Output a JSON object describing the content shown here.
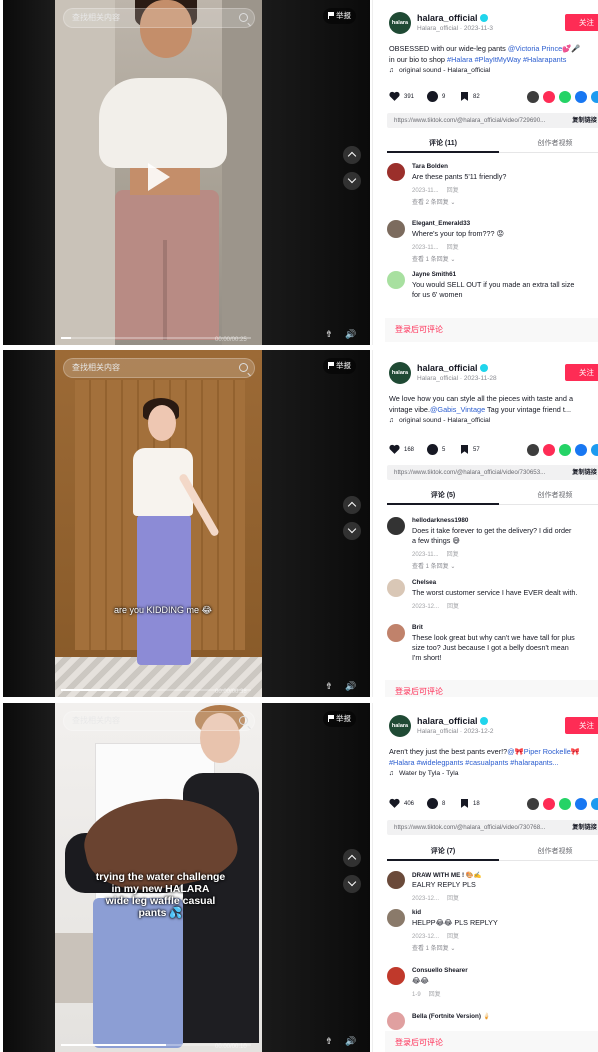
{
  "panels": [
    {
      "search_placeholder": "查找相关内容",
      "report_label": "举报",
      "video_time": "00:00/00:25",
      "progress": 0.05,
      "caption": [],
      "username": "halara_official",
      "avatar_text": "halara",
      "subline": "Halara_official · 2023-11-3",
      "follow_label": "关注",
      "desc_lines": [
        [
          {
            "t": "OBSESSED with our wide-leg pants "
          },
          {
            "t": "@Victoria Prince",
            "link": true
          },
          {
            "t": "💕🎤"
          }
        ],
        [
          {
            "t": "in our bio to shop "
          },
          {
            "t": "#Halara #PlayItMyWay #Halarapants",
            "link": true
          }
        ]
      ],
      "music": "original sound - Halara_official",
      "likes": "391",
      "comments": "9",
      "saves": "82",
      "url": "https://www.tiktok.com/@halara_official/video/729690...",
      "copy_label": "复制链接",
      "tab_comments": "评论 (11)",
      "tab_creator": "创作者视频",
      "comment_list": [
        {
          "user": "Tara Bolden",
          "lines": [
            "Are these pants 5'11 friendly?"
          ],
          "date": "2023-11...",
          "reply": "回复",
          "more": "查看 2 条回复",
          "color": "#9b2f2b"
        },
        {
          "user": "Elegant_Emerald33",
          "lines": [
            "Where's your top from??? 😡"
          ],
          "date": "2023-11...",
          "reply": "回复",
          "more": "查看 1 条回复",
          "color": "#7c6b5e"
        },
        {
          "user": "Jayne Smith61",
          "lines": [
            "You would SELL OUT if you made an extra tall size",
            "for us 6' women"
          ],
          "date": "",
          "reply": "",
          "more": "",
          "color": "#a8e0a0"
        }
      ],
      "login_label": "登录后可评论"
    },
    {
      "search_placeholder": "查找相关内容",
      "report_label": "举报",
      "video_time": "00:00/00:38",
      "progress": 0.35,
      "caption": [
        "are you KIDDING me 😂"
      ],
      "username": "halara_official",
      "avatar_text": "halara",
      "subline": "Halara_official · 2023-11-28",
      "follow_label": "关注",
      "desc_lines": [
        [
          {
            "t": "We love how you can style all the pieces with taste and a"
          }
        ],
        [
          {
            "t": "vintage vibe."
          },
          {
            "t": "@Gabis_Vintage",
            "link": true
          },
          {
            "t": " Tag your vintage friend t..."
          }
        ]
      ],
      "music": "original sound - Halara_official",
      "likes": "168",
      "comments": "5",
      "saves": "57",
      "url": "https://www.tiktok.com/@halara_official/video/730653...",
      "copy_label": "复制链接",
      "tab_comments": "评论 (5)",
      "tab_creator": "创作者视频",
      "comment_list": [
        {
          "user": "hellodarkness1980",
          "lines": [
            "Does it take forever to get the delivery? I did order",
            "a few things 😅"
          ],
          "date": "2023-11...",
          "reply": "回复",
          "more": "查看 1 条回复",
          "color": "#333333"
        },
        {
          "user": "Chelsea",
          "lines": [
            "The worst customer service I have EVER dealt with."
          ],
          "date": "2023-12...",
          "reply": "回复",
          "more": "",
          "color": "#d9c7b6"
        },
        {
          "user": "Brit",
          "lines": [
            "These look great but why can't we have tall for plus",
            "size too? Just because I got a belly doesn't mean",
            "I'm short!"
          ],
          "date": "",
          "reply": "",
          "more": "",
          "color": "#c0826b"
        }
      ],
      "login_label": "登录后可评论"
    },
    {
      "search_placeholder": "查找相关内容",
      "report_label": "举报",
      "video_time": "00:00/00:10",
      "progress": 0.55,
      "caption": [
        "trying the water challenge",
        "in my new HALARA",
        "wide leg waffle casual",
        "pants 💦"
      ],
      "username": "halara_official",
      "avatar_text": "halara",
      "subline": "Halara_official · 2023-12-2",
      "follow_label": "关注",
      "desc_lines": [
        [
          {
            "t": "Aren't they just the best pants ever!?"
          },
          {
            "t": "@🎀Piper Rockelle🎀",
            "link": true
          }
        ],
        [
          {
            "t": "#Halara #widelegpants #casualpants #halarapants...",
            "link": true
          }
        ]
      ],
      "music": "Water by Tyla - Tyla",
      "likes": "406",
      "comments": "8",
      "saves": "18",
      "url": "https://www.tiktok.com/@halara_official/video/730768...",
      "copy_label": "复制链接",
      "tab_comments": "评论 (7)",
      "tab_creator": "创作者视频",
      "comment_list": [
        {
          "user": "DRAW WITH ME ! 🎨✍️",
          "lines": [
            "EALRY REPLY PLS"
          ],
          "date": "2023-12...",
          "reply": "回复",
          "more": "",
          "color": "#6a4a3a"
        },
        {
          "user": "kid",
          "lines": [
            "HELPP😂😂 PLS REPLYY"
          ],
          "date": "2023-12...",
          "reply": "回复",
          "more": "查看 1 条回复",
          "color": "#8a7a6a"
        },
        {
          "user": "Consuello Shearer",
          "lines": [
            "😂😂"
          ],
          "date": "1-9",
          "reply": "回复",
          "more": "",
          "color": "#c0392b"
        },
        {
          "user": "Bella (Fortnite Version) 🍦",
          "lines": [],
          "date": "",
          "reply": "",
          "more": "",
          "color": "#e0a0a0"
        }
      ],
      "login_label": "登录后可评论"
    }
  ]
}
